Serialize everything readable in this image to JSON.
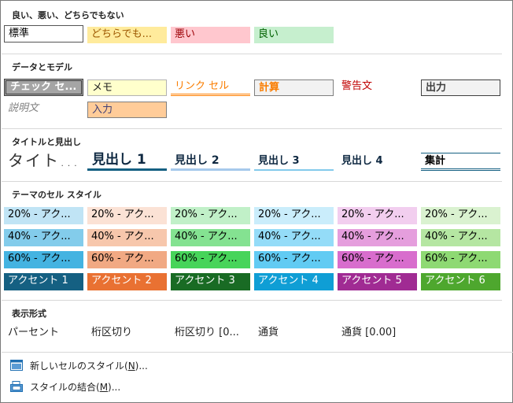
{
  "sections": {
    "good_bad": "良い、悪い、どちらでもない",
    "data_model": "データとモデル",
    "titles": "タイトルと見出し",
    "theme": "テーマのセル スタイル",
    "number_format": "表示形式"
  },
  "good_bad": {
    "normal": "標準",
    "neutral": "どちらでも...",
    "bad": "悪い",
    "good": "良い"
  },
  "data_model": {
    "check_cell": "チェック セ...",
    "note": "メモ",
    "linked_cell": "リンク セル",
    "calculation": "計算",
    "warning_text": "警告文",
    "output": "出力",
    "explanatory": "説明文",
    "input": "入力"
  },
  "titles": {
    "title": "タイト...",
    "heading1": "見出し 1",
    "heading2": "見出し 2",
    "heading3": "見出し 3",
    "heading4": "見出し 4",
    "total": "集計"
  },
  "theme": {
    "row20": [
      "20% - アク...",
      "20% - アク...",
      "20% - アク...",
      "20% - アク...",
      "20% - アク...",
      "20% - アク..."
    ],
    "row40": [
      "40% - アク...",
      "40% - アク...",
      "40% - アク...",
      "40% - アク...",
      "40% - アク...",
      "40% - アク..."
    ],
    "row60": [
      "60% - アク...",
      "60% - アク...",
      "60% - アク...",
      "60% - アク...",
      "60% - アク...",
      "60% - アク..."
    ],
    "accent": [
      "アクセント 1",
      "アクセント 2",
      "アクセント 3",
      "アクセント 4",
      "アクセント 5",
      "アクセント 6"
    ]
  },
  "number_format": {
    "percent": "パーセント",
    "comma": "桁区切り",
    "comma0": "桁区切り [0...",
    "currency": "通貨",
    "currency0": "通貨 [0.00]"
  },
  "menu": {
    "new_style_prefix": "新しいセルのスタイル(",
    "new_style_key": "N",
    "new_style_suffix": ")...",
    "merge_prefix": "スタイルの結合(",
    "merge_key": "M",
    "merge_suffix": ")..."
  },
  "colors": {
    "neutral_bg": "#FFEB9C",
    "neutral_fg": "#9C5700",
    "bad_bg": "#FFC7CE",
    "bad_fg": "#9C0006",
    "good_bg": "#C6EFCE",
    "good_fg": "#006100",
    "accent1": "#156082",
    "accent2": "#E97132",
    "accent3": "#196B24",
    "accent4": "#0F9ED5",
    "accent5": "#A02B93",
    "accent6": "#4EA72E"
  }
}
